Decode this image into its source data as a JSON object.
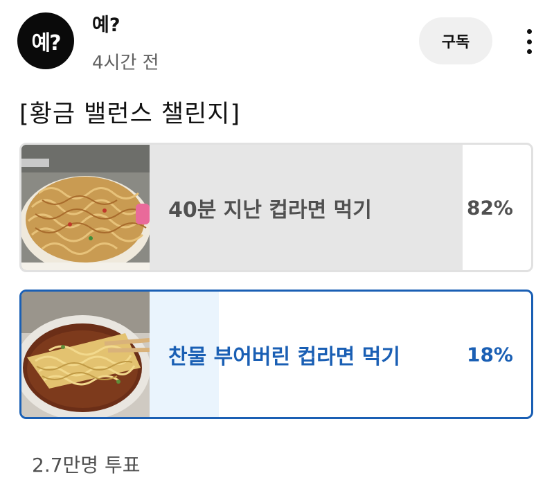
{
  "channel": {
    "avatar_text": "예?",
    "name": "예?",
    "time": "4시간 전",
    "subscribe_label": "구독"
  },
  "post": {
    "title": "[황금 밸런스 챌린지]"
  },
  "poll": {
    "options": [
      {
        "label": "40분 지난 컵라면 먹기",
        "percent_text": "82%",
        "percent": 82,
        "selected": false,
        "thumbnail": "soggy-cup-noodle-photo"
      },
      {
        "label": "찬물 부어버린 컵라면 먹기",
        "percent_text": "18%",
        "percent": 18,
        "selected": true,
        "thumbnail": "cold-water-cup-noodle-photo"
      }
    ],
    "vote_count": "2.7만명 투표"
  },
  "colors": {
    "selected_accent": "#1a5fb4",
    "selected_fill": "#eaf4fd",
    "unselected_fill": "#e6e6e6"
  },
  "icons": {
    "more": "more-vertical-icon"
  }
}
